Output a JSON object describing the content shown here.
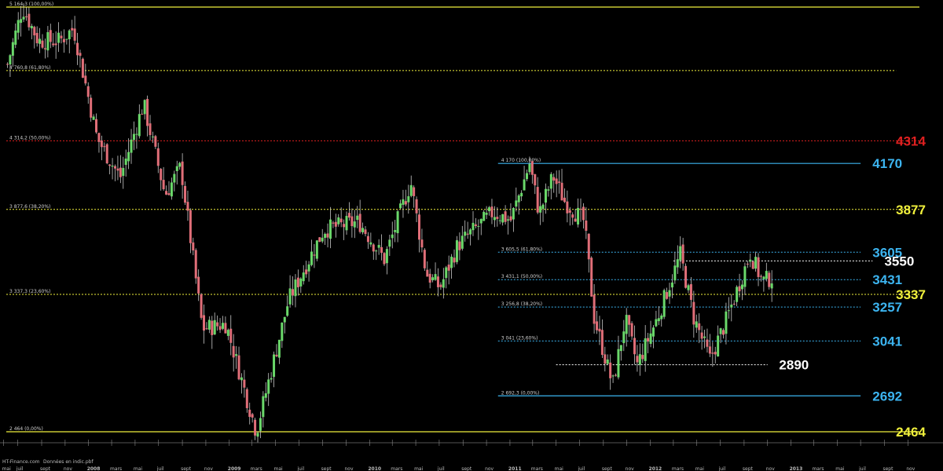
{
  "chart_data": {
    "type": "candlestick",
    "title": "",
    "xlabel": "",
    "ylabel": "",
    "x_range": [
      "2007-06",
      "2013-12"
    ],
    "y_range": [
      2464,
      5164.3
    ],
    "grid": false,
    "colors": {
      "up": "#6ad86a",
      "down": "#e06e78",
      "wick": "#c8c8c8",
      "yellow": "#f0f03c",
      "red": "#e02020",
      "blue": "#3cb4f0",
      "white": "#ffffff"
    },
    "price_path": [
      [
        "2007-06-01",
        4800
      ],
      [
        "2007-07-10",
        5164
      ],
      [
        "2007-08-20",
        4950
      ],
      [
        "2007-10-15",
        4950
      ],
      [
        "2007-11-20",
        5030
      ],
      [
        "2008-01-20",
        4330
      ],
      [
        "2008-03-20",
        4080
      ],
      [
        "2008-05-20",
        4550
      ],
      [
        "2008-07-15",
        3970
      ],
      [
        "2008-08-25",
        4150
      ],
      [
        "2008-10-20",
        3120
      ],
      [
        "2008-12-20",
        3150
      ],
      [
        "2009-03-09",
        2464
      ],
      [
        "2009-06-01",
        3300
      ],
      [
        "2009-09-01",
        3750
      ],
      [
        "2009-12-01",
        3800
      ],
      [
        "2010-02-05",
        3560
      ],
      [
        "2010-04-15",
        4050
      ],
      [
        "2010-05-25",
        3470
      ],
      [
        "2010-06-30",
        3380
      ],
      [
        "2010-08-15",
        3650
      ],
      [
        "2010-11-15",
        3860
      ],
      [
        "2010-12-31",
        3810
      ],
      [
        "2011-02-18",
        4170
      ],
      [
        "2011-03-15",
        3850
      ],
      [
        "2011-04-20",
        4090
      ],
      [
        "2011-05-20",
        3930
      ],
      [
        "2011-07-10",
        3800
      ],
      [
        "2011-08-05",
        3190
      ],
      [
        "2011-09-22",
        2760
      ],
      [
        "2011-10-25",
        3180
      ],
      [
        "2011-11-25",
        2890
      ],
      [
        "2012-01-15",
        3180
      ],
      [
        "2012-03-16",
        3590
      ],
      [
        "2012-04-20",
        3190
      ],
      [
        "2012-06-01",
        2925
      ],
      [
        "2012-07-10",
        3150
      ],
      [
        "2012-09-14",
        3600
      ],
      [
        "2012-10-15",
        3420
      ],
      [
        "2012-11-15",
        3450
      ]
    ],
    "small_labels": {
      "fib_top": "5 164,3 (100,00%)",
      "fib_618": "4 760,8 (61,80%)",
      "fib_50": "4 314,2 (50,00%)",
      "fib_382": "3 877,6 (38,20%)",
      "fib_236": "3 337,3 (23,60%)",
      "fib_bottom": "2 464 (0,00%)",
      "fib2_top": "4 170 (100,00%)",
      "fib2_618": "3 605,5 (61,80%)",
      "fib2_50": "3 431,1 (50,00%)",
      "fib2_382": "3 256,8 (38,20%)",
      "fib2_236": "3 041 (23,60%)",
      "fib2_bottom": "2 692,3 (0,00%)"
    },
    "levels": [
      {
        "id": "fib_top",
        "value": 5164.3,
        "color": "#f0f03c",
        "dash": "solid",
        "from": "2007-06",
        "to": "2013-12"
      },
      {
        "id": "fib_618",
        "value": 4760.8,
        "color": "#f0f03c",
        "dash": "dot",
        "from": "2007-06",
        "to": "2013-10"
      },
      {
        "id": "fib_50",
        "value": 4314.2,
        "color": "#e02020",
        "dash": "dot",
        "from": "2007-06",
        "to": "2013-12"
      },
      {
        "id": "fib_382",
        "value": 3877.6,
        "color": "#f0f03c",
        "dash": "dot",
        "from": "2007-06",
        "to": "2013-12"
      },
      {
        "id": "fib_236",
        "value": 3337.3,
        "color": "#f0f03c",
        "dash": "dot",
        "from": "2007-06",
        "to": "2013-12"
      },
      {
        "id": "fib_bottom",
        "value": 2464,
        "color": "#f0f03c",
        "dash": "solid",
        "from": "2007-06",
        "to": "2013-12"
      },
      {
        "id": "fib2_top",
        "value": 4170,
        "color": "#3cb4f0",
        "dash": "solid",
        "from": "2010-12",
        "to": "2013-07"
      },
      {
        "id": "fib2_618",
        "value": 3605.5,
        "color": "#3cb4f0",
        "dash": "dot",
        "from": "2010-12",
        "to": "2013-07"
      },
      {
        "id": "fib2_50",
        "value": 3431.1,
        "color": "#3cb4f0",
        "dash": "dot",
        "from": "2010-12",
        "to": "2013-07"
      },
      {
        "id": "fib2_382",
        "value": 3256.8,
        "color": "#3cb4f0",
        "dash": "dot",
        "from": "2010-12",
        "to": "2013-07"
      },
      {
        "id": "fib2_236",
        "value": 3041,
        "color": "#3cb4f0",
        "dash": "dot",
        "from": "2010-12",
        "to": "2013-07"
      },
      {
        "id": "fib2_bottom",
        "value": 2692.3,
        "color": "#3cb4f0",
        "dash": "solid",
        "from": "2010-12",
        "to": "2013-07"
      },
      {
        "id": "res_3550",
        "value": 3550,
        "color": "#ffffff",
        "dash": "dot",
        "from": "2012-03",
        "to": "2013-08"
      },
      {
        "id": "sup_2890",
        "value": 2890,
        "color": "#ffffff",
        "dash": "dot",
        "from": "2011-05",
        "to": "2012-11"
      }
    ],
    "annotations": [
      {
        "text": "4314",
        "value": 4314.2,
        "color": "#e02020",
        "date": "2013-10"
      },
      {
        "text": "4170",
        "value": 4170,
        "color": "#3cb4f0",
        "date": "2013-08"
      },
      {
        "text": "3877",
        "value": 3877.6,
        "color": "#f0f03c",
        "date": "2013-10"
      },
      {
        "text": "3605",
        "value": 3605.5,
        "color": "#3cb4f0",
        "date": "2013-08"
      },
      {
        "text": "3550",
        "value": 3550,
        "color": "#ffffff",
        "date": "2013-09"
      },
      {
        "text": "3431",
        "value": 3431.1,
        "color": "#3cb4f0",
        "date": "2013-08"
      },
      {
        "text": "3337",
        "value": 3337.3,
        "color": "#f0f03c",
        "date": "2013-10"
      },
      {
        "text": "3257",
        "value": 3256.8,
        "color": "#3cb4f0",
        "date": "2013-08"
      },
      {
        "text": "3041",
        "value": 3041,
        "color": "#3cb4f0",
        "date": "2013-08"
      },
      {
        "text": "2890",
        "value": 2890,
        "color": "#ffffff",
        "date": "2012-12"
      },
      {
        "text": "2692",
        "value": 2692.3,
        "color": "#3cb4f0",
        "date": "2013-08"
      },
      {
        "text": "2464",
        "value": 2464,
        "color": "#f0f03c",
        "date": "2013-10"
      }
    ],
    "x_ticks": [
      {
        "label": "mai",
        "date": "2007-05-25",
        "bold": false
      },
      {
        "label": "juil",
        "date": "2007-07",
        "bold": false
      },
      {
        "label": "sept",
        "date": "2007-09",
        "bold": false
      },
      {
        "label": "nov",
        "date": "2007-11",
        "bold": false
      },
      {
        "label": "2008",
        "date": "2008-01",
        "bold": true
      },
      {
        "label": "mars",
        "date": "2008-03",
        "bold": false
      },
      {
        "label": "mai",
        "date": "2008-05",
        "bold": false
      },
      {
        "label": "juil",
        "date": "2008-07",
        "bold": false
      },
      {
        "label": "sept",
        "date": "2008-09",
        "bold": false
      },
      {
        "label": "nov",
        "date": "2008-11",
        "bold": false
      },
      {
        "label": "2009",
        "date": "2009-01",
        "bold": true
      },
      {
        "label": "mars",
        "date": "2009-03",
        "bold": false
      },
      {
        "label": "mai",
        "date": "2009-05",
        "bold": false
      },
      {
        "label": "juil",
        "date": "2009-07",
        "bold": false
      },
      {
        "label": "sept",
        "date": "2009-09",
        "bold": false
      },
      {
        "label": "nov",
        "date": "2009-11",
        "bold": false
      },
      {
        "label": "2010",
        "date": "2010-01",
        "bold": true
      },
      {
        "label": "mars",
        "date": "2010-03",
        "bold": false
      },
      {
        "label": "mai",
        "date": "2010-05",
        "bold": false
      },
      {
        "label": "juil",
        "date": "2010-07",
        "bold": false
      },
      {
        "label": "sept",
        "date": "2010-09",
        "bold": false
      },
      {
        "label": "nov",
        "date": "2010-11",
        "bold": false
      },
      {
        "label": "2011",
        "date": "2011-01",
        "bold": true
      },
      {
        "label": "mars",
        "date": "2011-03",
        "bold": false
      },
      {
        "label": "mai",
        "date": "2011-05",
        "bold": false
      },
      {
        "label": "juil",
        "date": "2011-07",
        "bold": false
      },
      {
        "label": "sept",
        "date": "2011-09",
        "bold": false
      },
      {
        "label": "nov",
        "date": "2011-11",
        "bold": false
      },
      {
        "label": "2012",
        "date": "2012-01",
        "bold": true
      },
      {
        "label": "mars",
        "date": "2012-03",
        "bold": false
      },
      {
        "label": "mai",
        "date": "2012-05",
        "bold": false
      },
      {
        "label": "juil",
        "date": "2012-07",
        "bold": false
      },
      {
        "label": "sept",
        "date": "2012-09",
        "bold": false
      },
      {
        "label": "nov",
        "date": "2012-11",
        "bold": false
      },
      {
        "label": "2013",
        "date": "2013-01",
        "bold": true
      },
      {
        "label": "mars",
        "date": "2013-03",
        "bold": false
      },
      {
        "label": "mai",
        "date": "2013-05",
        "bold": false
      },
      {
        "label": "juil",
        "date": "2013-07",
        "bold": false
      },
      {
        "label": "sept",
        "date": "2013-09",
        "bold": false
      },
      {
        "label": "nov",
        "date": "2013-11",
        "bold": false
      }
    ],
    "footer_source": "HT-Finance.com",
    "footer_note": "Données en indic.pbf"
  }
}
